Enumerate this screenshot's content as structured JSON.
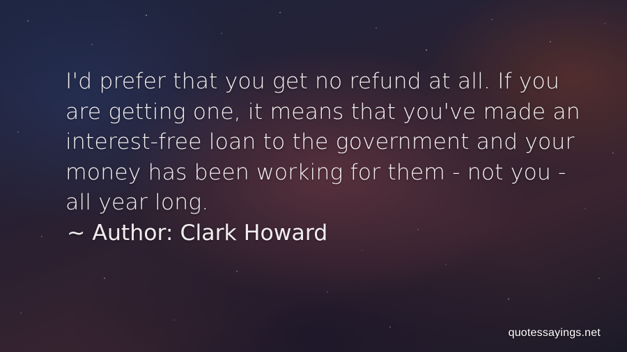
{
  "quote": {
    "text": "I'd prefer that you get no refund at all. If you are getting one, it means that you've made an interest-free loan to the government and your money has been working for them - not you - all year long.",
    "author_prefix": "~",
    "author_label": "Author:",
    "author_name": "Clark Howard"
  },
  "watermark": {
    "text": "quotessayings.net"
  },
  "colors": {
    "text": "#f2eef0",
    "background": "#1f1a2a"
  }
}
